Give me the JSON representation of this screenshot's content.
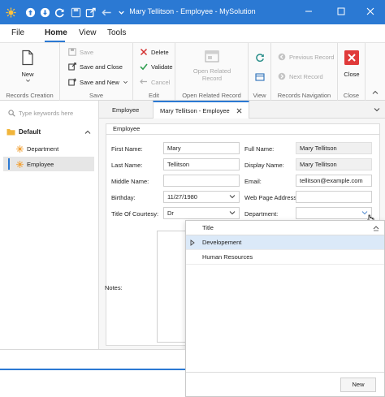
{
  "window": {
    "title": "Mary Tellitson - Employee - MySolution",
    "accent": "#2b79d3"
  },
  "menu_tabs": [
    {
      "label": "File"
    },
    {
      "label": "Home"
    },
    {
      "label": "View"
    },
    {
      "label": "Tools"
    }
  ],
  "ribbon": {
    "records_creation": {
      "new_label": "New",
      "group_label": "Records Creation"
    },
    "save": {
      "save_label": "Save",
      "save_close_label": "Save and Close",
      "save_new_label": "Save and New",
      "group_label": "Save"
    },
    "edit": {
      "delete_label": "Delete",
      "validate_label": "Validate",
      "cancel_label": "Cancel",
      "group_label": "Edit"
    },
    "open_related": {
      "button_label": "Open Related Record",
      "group_label": "Open Related Record"
    },
    "view": {
      "group_label": "View"
    },
    "records_nav": {
      "prev_label": "Previous Record",
      "next_label": "Next Record",
      "group_label": "Records Navigation"
    },
    "close": {
      "close_label": "Close",
      "group_label": "Close"
    }
  },
  "sidebar": {
    "search_placeholder": "Type keywords here",
    "group_label": "Default",
    "items": [
      {
        "label": "Department"
      },
      {
        "label": "Employee"
      }
    ]
  },
  "doc_tabs": [
    {
      "label": "Employee"
    },
    {
      "label": "Mary Tellitson - Employee"
    }
  ],
  "form": {
    "section_title": "Employee",
    "first_name_label": "First Name:",
    "first_name_value": "Mary",
    "last_name_label": "Last Name:",
    "last_name_value": "Tellitson",
    "middle_name_label": "Middle Name:",
    "middle_name_value": "",
    "birthday_label": "Birthday:",
    "birthday_value": "11/27/1980",
    "courtesy_label": "Title Of Courtesy:",
    "courtesy_value": "Dr",
    "full_name_label": "Full Name:",
    "full_name_value": "Mary Tellitson",
    "display_name_label": "Display Name:",
    "display_name_value": "Mary Tellitson",
    "email_label": "Email:",
    "email_value": "tellitson@example.com",
    "web_page_label": "Web Page Address:",
    "web_page_value": "",
    "department_label": "Department:",
    "department_value": "",
    "notes_label": "Notes:"
  },
  "department_dropdown": {
    "column_header": "Title",
    "rows": [
      {
        "title": "Developement"
      },
      {
        "title": "Human Resources"
      }
    ],
    "new_label": "New"
  }
}
